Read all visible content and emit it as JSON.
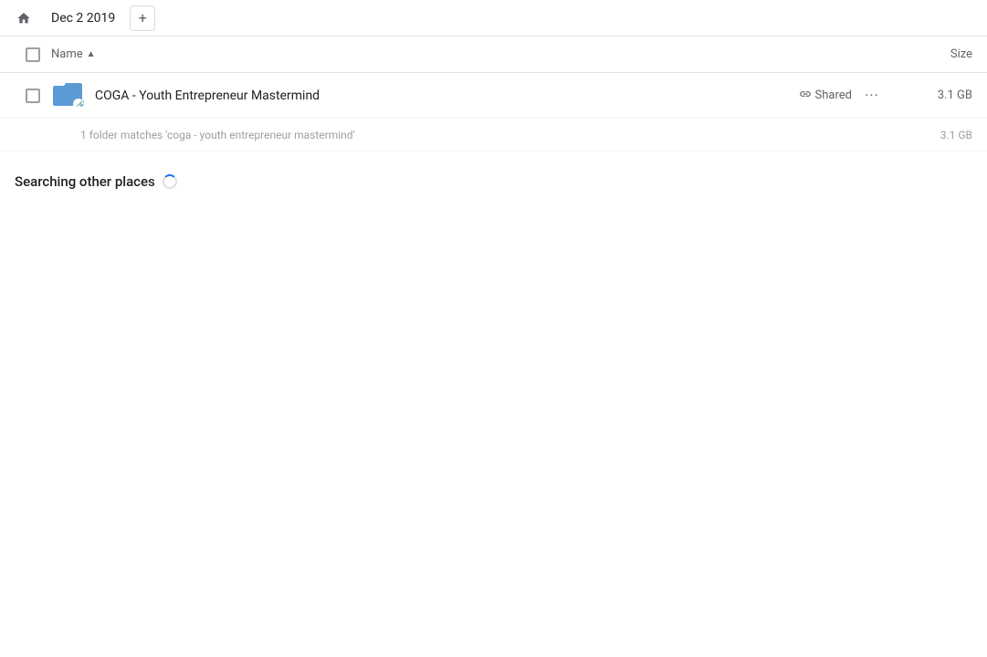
{
  "topbar": {
    "home_icon": "⌂",
    "breadcrumb_label": "Dec 2 2019",
    "add_btn_label": "+"
  },
  "columns": {
    "name_label": "Name",
    "size_label": "Size",
    "sort_indicator": "▲"
  },
  "file_row": {
    "name": "COGA - Youth Entrepreneur Mastermind",
    "shared_label": "Shared",
    "more_label": "···",
    "size": "3.1 GB"
  },
  "match_info": {
    "text": "1 folder matches 'coga - youth entrepreneur mastermind'",
    "size": "3.1 GB"
  },
  "searching_section": {
    "label": "Searching other places"
  }
}
